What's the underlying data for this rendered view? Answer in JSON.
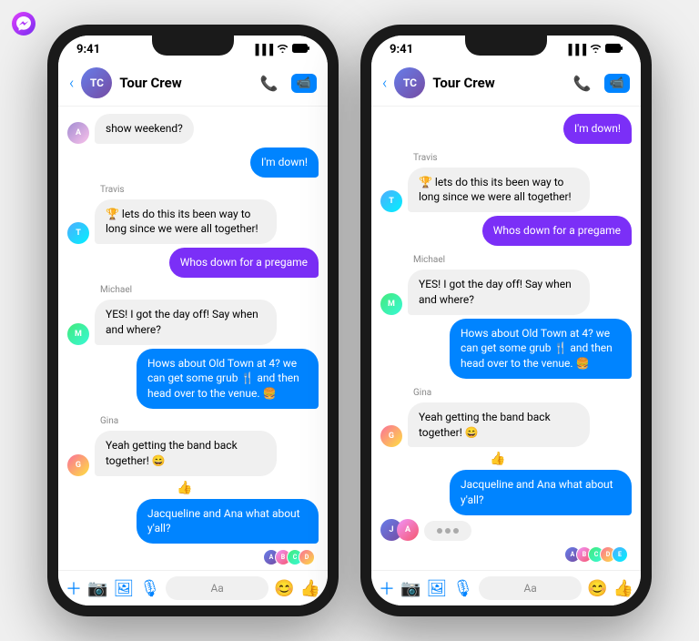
{
  "app": {
    "name": "Messenger",
    "icon": "messenger-icon"
  },
  "phone1": {
    "statusBar": {
      "time": "9:41",
      "signal": "▐▐▐",
      "wifi": "wifi",
      "battery": "battery"
    },
    "header": {
      "back": "<",
      "groupName": "Tour Crew",
      "callIcon": "📞",
      "videoIcon": "🎥"
    },
    "messages": [
      {
        "id": 1,
        "type": "incoming",
        "sender": "",
        "avatar": "first",
        "text": "show weekend?"
      },
      {
        "id": 2,
        "type": "outgoing",
        "color": "blue",
        "text": "I'm down!"
      },
      {
        "id": 3,
        "type": "incoming",
        "sender": "Travis",
        "avatar": "travis",
        "text": "🏆 lets do this its been way to long since we were all together!"
      },
      {
        "id": 4,
        "type": "outgoing",
        "color": "purple",
        "text": "Whos down for a pregame"
      },
      {
        "id": 5,
        "type": "incoming",
        "sender": "Michael",
        "avatar": "michael",
        "text": "YES! I got the day off! Say when and where?"
      },
      {
        "id": 6,
        "type": "outgoing",
        "color": "blue",
        "text": "Hows about Old Town at 4? we can get some grub 🍴 and then head over to the venue. 🍔"
      },
      {
        "id": 7,
        "type": "incoming",
        "sender": "Gina",
        "avatar": "gina",
        "text": "Yeah getting the band back together! 😄"
      },
      {
        "id": 8,
        "type": "outgoing",
        "color": "blue",
        "text": "Jacqueline and Ana what about y'all?"
      }
    ],
    "inputBar": {
      "plusIcon": "+",
      "cameraIcon": "📷",
      "photoIcon": "🖼️",
      "micIcon": "🎙️",
      "placeholder": "Aa",
      "emojiIcon": "😊",
      "thumbIcon": "👍"
    }
  },
  "phone2": {
    "statusBar": {
      "time": "9:41",
      "signal": "▐▐▐",
      "wifi": "wifi",
      "battery": "battery"
    },
    "header": {
      "back": "<",
      "groupName": "Tour Crew",
      "callIcon": "📞",
      "videoIcon": "🎥"
    },
    "messages": [
      {
        "id": 1,
        "type": "outgoing",
        "color": "purple",
        "text": "I'm down!"
      },
      {
        "id": 2,
        "type": "incoming",
        "sender": "Travis",
        "avatar": "travis",
        "text": "🏆 lets do this its been way to long since we were all together!"
      },
      {
        "id": 3,
        "type": "outgoing",
        "color": "purple",
        "text": "Whos down for a pregame"
      },
      {
        "id": 4,
        "type": "incoming",
        "sender": "Michael",
        "avatar": "michael",
        "text": "YES! I got the day off! Say when and where?"
      },
      {
        "id": 5,
        "type": "outgoing",
        "color": "blue",
        "text": "Hows about Old Town at 4? we can get some grub 🍴 and then head over to the venue. 🍔"
      },
      {
        "id": 6,
        "type": "incoming",
        "sender": "Gina",
        "avatar": "gina",
        "text": "Yeah getting the band back together! 😄"
      },
      {
        "id": 7,
        "type": "outgoing",
        "color": "blue-alt",
        "text": "Jacqueline and Ana what about y'all?"
      }
    ],
    "inputBar": {
      "plusIcon": "+",
      "cameraIcon": "📷",
      "photoIcon": "🖼️",
      "micIcon": "🎙️",
      "placeholder": "Aa",
      "emojiIcon": "😊",
      "thumbIcon": "👍"
    }
  }
}
